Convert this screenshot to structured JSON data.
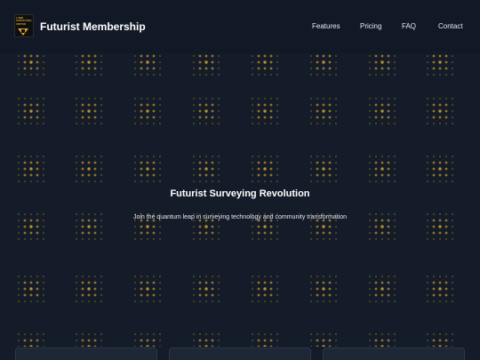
{
  "header": {
    "logo_text": "LAND SURVEYING UNITED",
    "brand": "Futurist Membership",
    "nav": [
      "Features",
      "Pricing",
      "FAQ",
      "Contact"
    ]
  },
  "hero": {
    "title": "Futurist Surveying Revolution",
    "subtitle": "Join the quantum leap in surveying technology and community transformation"
  },
  "cards": [
    {},
    {},
    {}
  ],
  "colors": {
    "background": "#151c29",
    "header": "#121926",
    "accent": "#d9a22a",
    "card": "#1e2736"
  }
}
